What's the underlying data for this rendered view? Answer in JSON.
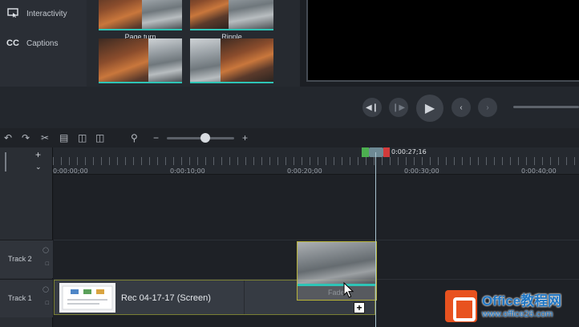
{
  "tools": [
    {
      "label": "Interactivity",
      "icon": "interactivity-icon"
    },
    {
      "label": "Captions",
      "icon": "captions-icon",
      "glyph": "CC"
    }
  ],
  "transitions": [
    {
      "label": "Page turn"
    },
    {
      "label": "Ripple"
    },
    {
      "label": ""
    },
    {
      "label": ""
    }
  ],
  "player": {
    "icons": [
      "step-back-icon",
      "step-forward-icon",
      "play-icon",
      "previous-marker-icon",
      "next-marker-icon"
    ]
  },
  "timeline": {
    "toolbar_icons": [
      "undo-icon",
      "redo-icon",
      "cut-icon",
      "copy-icon",
      "paste-icon",
      "split-icon",
      "zoom-icon",
      "zoom-out-icon",
      "zoom-in-icon"
    ],
    "zoom_level": 0.55,
    "ruler_labels": [
      "0:00:00;00",
      "0:00:10;00",
      "0:00:20;00",
      "0:00:30;00",
      "0:00:40;00"
    ],
    "playhead_time": "0:00:27;16",
    "tracks": [
      {
        "name": "Track 2"
      },
      {
        "name": "Track 1"
      }
    ],
    "clip_title": "Rec 04-17-17 (Screen)",
    "dragged_transition_label": "Fade"
  },
  "watermark": {
    "title": "Office教程网",
    "url": "www.office26.com"
  },
  "colors": {
    "accent_teal": "#2ec4b6",
    "clip_border": "#b7b239",
    "in_marker": "#4caf50",
    "out_marker": "#d23b3b"
  }
}
